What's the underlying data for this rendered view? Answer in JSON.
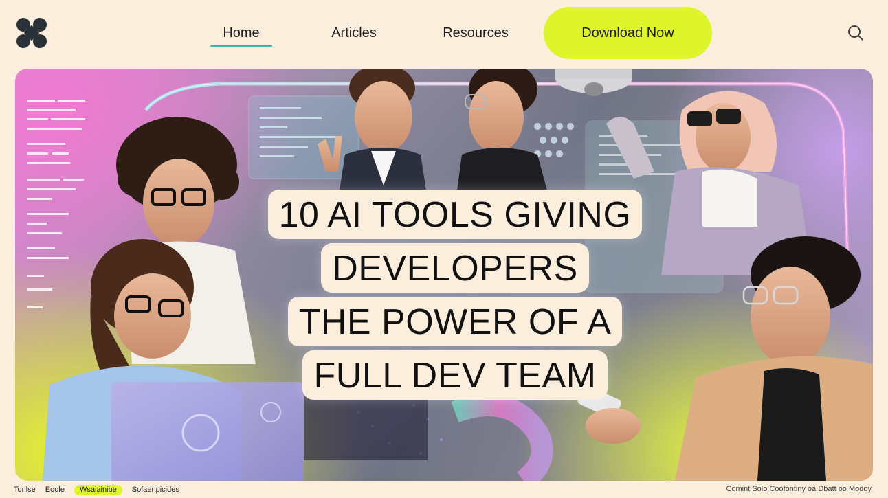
{
  "nav": {
    "items": [
      {
        "label": "Home",
        "active": true
      },
      {
        "label": "Articles",
        "active": false
      },
      {
        "label": "Resources",
        "active": false
      }
    ],
    "cta_label": "Download Now"
  },
  "hero": {
    "headline_lines": [
      "10 AI TOOLS GIVING",
      "DEVELOPERS",
      "THE POWER OF A",
      "FULL DEV TEAM"
    ]
  },
  "footer": {
    "left_items": [
      "Tonlse",
      "Eoole",
      "Wsaiainibe",
      "Sofaenpicides"
    ],
    "right_text": "Comint Solo Coofontiny oa Dbatt oo Modoy"
  },
  "colors": {
    "background": "#fbeedc",
    "accent_lime": "#ddf52a",
    "active_underline": "#3bb4a4",
    "text": "#1c1c1c"
  },
  "icons": {
    "logo": "four-dot-logo-icon",
    "search": "search-icon"
  }
}
